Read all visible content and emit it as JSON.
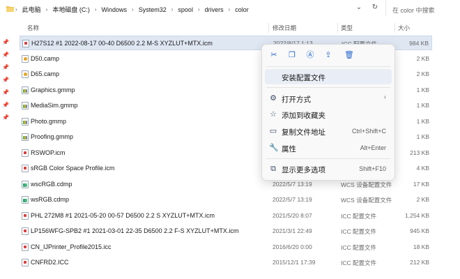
{
  "breadcrumb": [
    "此电脑",
    "本地磁盘 (C:)",
    "Windows",
    "System32",
    "spool",
    "drivers",
    "color"
  ],
  "search": {
    "placeholder": "在 color 中搜索"
  },
  "columns": {
    "name": "名称",
    "date": "修改日期",
    "type": "类型",
    "size": "大小"
  },
  "files": [
    {
      "name": "H27S12 #1 2022-08-17 00-40 D6500 2.2 M-S XYZLUT+MTX.icm",
      "date": "2022/8/17 1:13",
      "type": "ICC 配置文件",
      "size": "984 KB",
      "icon": "icm",
      "selected": true
    },
    {
      "name": "D50.camp",
      "date": "",
      "type": "",
      "size": "2 KB",
      "icon": "camp"
    },
    {
      "name": "D65.camp",
      "date": "",
      "type": "",
      "size": "2 KB",
      "icon": "camp"
    },
    {
      "name": "Graphics.gmmp",
      "date": "",
      "type": "",
      "size": "1 KB",
      "icon": "gmmp"
    },
    {
      "name": "MediaSim.gmmp",
      "date": "",
      "type": "",
      "size": "1 KB",
      "icon": "gmmp"
    },
    {
      "name": "Photo.gmmp",
      "date": "",
      "type": "",
      "size": "1 KB",
      "icon": "gmmp"
    },
    {
      "name": "Proofing.gmmp",
      "date": "",
      "type": "",
      "size": "1 KB",
      "icon": "gmmp"
    },
    {
      "name": "RSWOP.icm",
      "date": "",
      "type": "",
      "size": "213 KB",
      "icon": "icm"
    },
    {
      "name": "sRGB Color Space Profile.icm",
      "date": "",
      "type": "",
      "size": "4 KB",
      "icon": "icm"
    },
    {
      "name": "wscRGB.cdmp",
      "date": "2022/5/7 13:19",
      "type": "WCS 设备配置文件",
      "size": "17 KB",
      "icon": "cdmp"
    },
    {
      "name": "wsRGB.cdmp",
      "date": "2022/5/7 13:19",
      "type": "WCS 设备配置文件",
      "size": "2 KB",
      "icon": "cdmp"
    },
    {
      "name": "PHL 272M8 #1 2021-05-20 00-57 D6500 2.2 S XYZLUT+MTX.icm",
      "date": "2021/5/20 8:07",
      "type": "ICC 配置文件",
      "size": "1,254 KB",
      "icon": "icm"
    },
    {
      "name": "LP156WFG-SPB2 #1 2021-03-01 22-35 D6500 2.2 F-S XYZLUT+MTX.icm",
      "date": "2021/3/1 22:49",
      "type": "ICC 配置文件",
      "size": "945 KB",
      "icon": "icm"
    },
    {
      "name": "CN_IJPrinter_Profile2015.icc",
      "date": "2016/6/20 0:00",
      "type": "ICC 配置文件",
      "size": "18 KB",
      "icon": "icm"
    },
    {
      "name": "CNFRD2.ICC",
      "date": "2015/12/1 17:39",
      "type": "ICC 配置文件",
      "size": "212 KB",
      "icon": "icm"
    }
  ],
  "context_menu": {
    "quick_actions": [
      "cut-icon",
      "copy-icon",
      "rename-icon",
      "share-icon",
      "delete-icon"
    ],
    "items": [
      {
        "label": "安装配置文件",
        "shortcut": "",
        "icon": "",
        "hover": true
      },
      {
        "label": "打开方式",
        "shortcut": "",
        "icon": "open-with-icon",
        "submenu": true
      },
      {
        "label": "添加到收藏夹",
        "shortcut": "",
        "icon": "star-icon"
      },
      {
        "label": "复制文件地址",
        "shortcut": "Ctrl+Shift+C",
        "icon": "copy-path-icon"
      },
      {
        "label": "属性",
        "shortcut": "Alt+Enter",
        "icon": "wrench-icon"
      },
      {
        "label": "显示更多选项",
        "shortcut": "Shift+F10",
        "icon": "more-options-icon"
      }
    ]
  },
  "colors": {
    "selection": "#dfe7f3",
    "accent": "#2a6bd1"
  }
}
